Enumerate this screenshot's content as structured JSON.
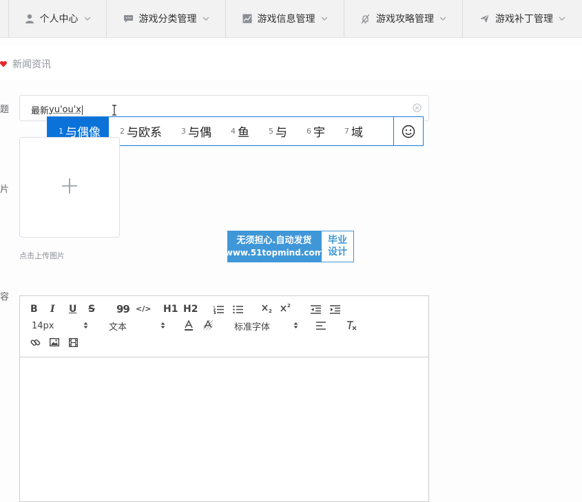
{
  "nav": {
    "items": [
      {
        "label": "个人中心",
        "icon": "user-icon"
      },
      {
        "label": "游戏分类管理",
        "icon": "comment-icon"
      },
      {
        "label": "游戏信息管理",
        "icon": "chart-icon"
      },
      {
        "label": "游戏攻略管理",
        "icon": "bell-off-icon"
      },
      {
        "label": "游戏补丁管理",
        "icon": "send-icon"
      }
    ]
  },
  "breadcrumb": {
    "current": "新闻资讯"
  },
  "form": {
    "title_label": "标题",
    "title_value_prefix": "最新",
    "title_value_composing": "yu'ou'x",
    "image_label": "图片",
    "upload_hint": "点击上传图片",
    "content_label": "内容"
  },
  "ime": {
    "candidates": [
      {
        "num": "1",
        "text": "与偶像"
      },
      {
        "num": "2",
        "text": "与欧系"
      },
      {
        "num": "3",
        "text": "与偶"
      },
      {
        "num": "4",
        "text": "鱼"
      },
      {
        "num": "5",
        "text": "与"
      },
      {
        "num": "6",
        "text": "宇"
      },
      {
        "num": "7",
        "text": "域"
      }
    ],
    "accent": "#0a72d8"
  },
  "watermark": {
    "line1": "无须担心.自动发货",
    "line2": "www.51topmind.com",
    "side1": "毕业",
    "side2": "设计"
  },
  "editor": {
    "bold": "B",
    "italic": "I",
    "underline": "U",
    "strike": "S",
    "quote": "99",
    "code": "</>",
    "h1": "H1",
    "h2": "H2",
    "font_size": "14px",
    "header_picker": "文本",
    "font_family": "标准字体"
  }
}
